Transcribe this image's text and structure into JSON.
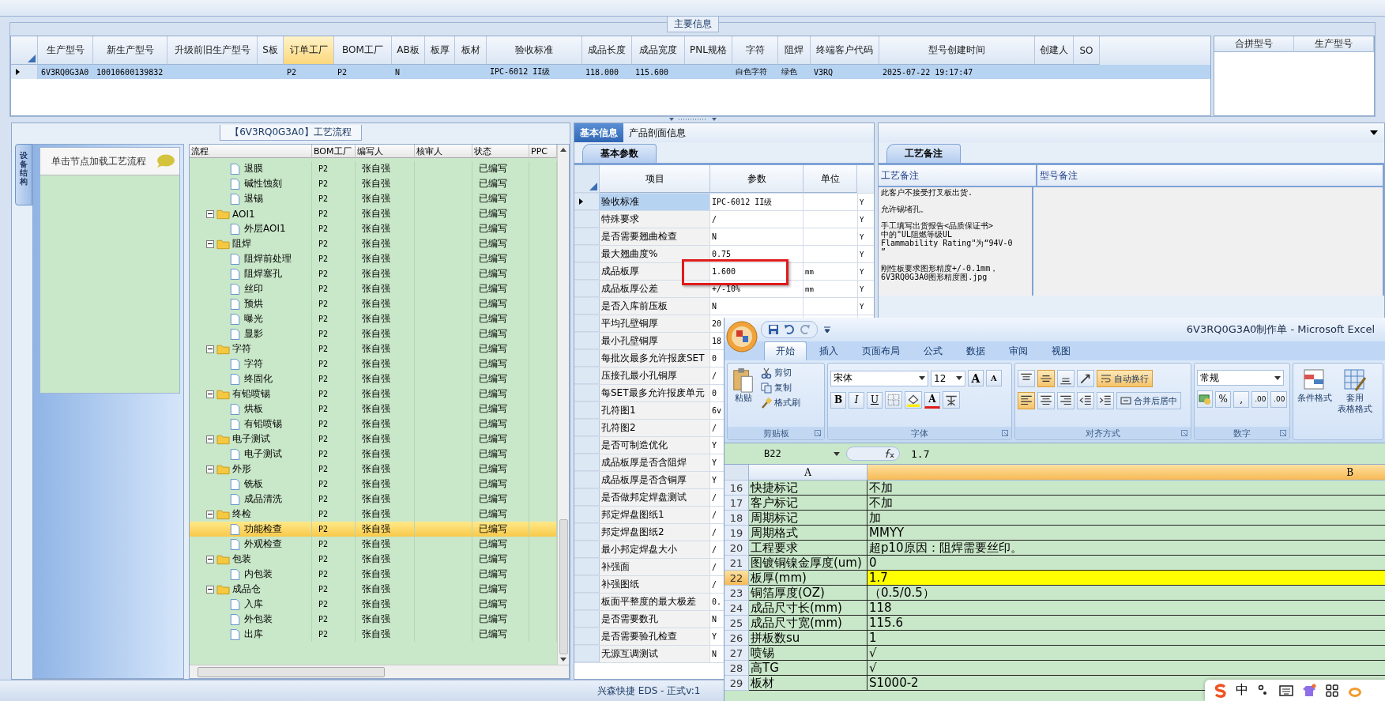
{
  "main_info": {
    "title": "主要信息",
    "columns": [
      {
        "label": "生产型号",
        "selected": false
      },
      {
        "label": "新生产型号",
        "selected": false
      },
      {
        "label": "升级前旧生产型号",
        "selected": false
      },
      {
        "label": "S板",
        "selected": false
      },
      {
        "label": "订单工厂",
        "selected": true
      },
      {
        "label": "BOM工厂",
        "selected": false
      },
      {
        "label": "AB板",
        "selected": false
      },
      {
        "label": "板厚",
        "selected": false
      },
      {
        "label": "板材",
        "selected": false
      },
      {
        "label": "验收标准",
        "selected": false
      },
      {
        "label": "成品长度",
        "selected": false
      },
      {
        "label": "成品宽度",
        "selected": false
      },
      {
        "label": "PNL规格",
        "selected": false
      },
      {
        "label": "字符",
        "selected": false
      },
      {
        "label": "阻焊",
        "selected": false
      },
      {
        "label": "终端客户代码",
        "selected": false
      },
      {
        "label": "型号创建时间",
        "selected": false
      },
      {
        "label": "创建人",
        "selected": false
      },
      {
        "label": "SO",
        "selected": false
      }
    ],
    "rows": [
      {
        "selected": true,
        "cells": [
          "6V3RQ0G3A0",
          "10010600139832",
          "",
          "",
          "P2",
          "P2",
          "N",
          "",
          "",
          "IPC-6012 II级",
          "118.000",
          "115.600",
          "",
          "白色字符",
          "绿色",
          "V3RQ",
          "2025-07-22 19:17:47",
          "",
          ""
        ]
      }
    ],
    "side_columns": [
      "合拼型号",
      "生产型号"
    ]
  },
  "process": {
    "title": "【6V3RQ0G3A0】工艺流程",
    "side_tab": "设备结构",
    "hint": "单击节点加载工艺流程",
    "columns": [
      "流程",
      "BOM工厂",
      "编写人",
      "核审人",
      "状态",
      "PPC"
    ],
    "tree": [
      {
        "kind": "step",
        "name": "退膜",
        "bom": "P2",
        "writer": "张自强",
        "status": "已编写",
        "selected": false
      },
      {
        "kind": "step",
        "name": "碱性蚀刻",
        "bom": "P2",
        "writer": "张自强",
        "status": "已编写",
        "selected": false
      },
      {
        "kind": "step",
        "name": "退锡",
        "bom": "P2",
        "writer": "张自强",
        "status": "已编写",
        "selected": false
      },
      {
        "kind": "folder",
        "name": "AOI1",
        "bom": "P2",
        "writer": "张自强",
        "status": "已编写",
        "selected": false,
        "expanded": true,
        "children": [
          {
            "kind": "step",
            "name": "外层AOI1",
            "bom": "P2",
            "writer": "张自强",
            "status": "已编写",
            "selected": false
          }
        ]
      },
      {
        "kind": "folder",
        "name": "阻焊",
        "bom": "P2",
        "writer": "张自强",
        "status": "已编写",
        "selected": false,
        "expanded": true,
        "children": [
          {
            "kind": "step",
            "name": "阻焊前处理",
            "bom": "P2",
            "writer": "张自强",
            "status": "已编写",
            "selected": false
          },
          {
            "kind": "step",
            "name": "阻焊塞孔",
            "bom": "P2",
            "writer": "张自强",
            "status": "已编写",
            "selected": false
          },
          {
            "kind": "step",
            "name": "丝印",
            "bom": "P2",
            "writer": "张自强",
            "status": "已编写",
            "selected": false
          },
          {
            "kind": "step",
            "name": "预烘",
            "bom": "P2",
            "writer": "张自强",
            "status": "已编写",
            "selected": false
          },
          {
            "kind": "step",
            "name": "曝光",
            "bom": "P2",
            "writer": "张自强",
            "status": "已编写",
            "selected": false
          },
          {
            "kind": "step",
            "name": "显影",
            "bom": "P2",
            "writer": "张自强",
            "status": "已编写",
            "selected": false
          }
        ]
      },
      {
        "kind": "folder",
        "name": "字符",
        "bom": "P2",
        "writer": "张自强",
        "status": "已编写",
        "selected": false,
        "expanded": true,
        "children": [
          {
            "kind": "step",
            "name": "字符",
            "bom": "P2",
            "writer": "张自强",
            "status": "已编写",
            "selected": false
          },
          {
            "kind": "step",
            "name": "终固化",
            "bom": "P2",
            "writer": "张自强",
            "status": "已编写",
            "selected": false
          }
        ]
      },
      {
        "kind": "folder",
        "name": "有铅喷锡",
        "bom": "P2",
        "writer": "张自强",
        "status": "已编写",
        "selected": false,
        "expanded": true,
        "children": [
          {
            "kind": "step",
            "name": "烘板",
            "bom": "P2",
            "writer": "张自强",
            "status": "已编写",
            "selected": false
          },
          {
            "kind": "step",
            "name": "有铅喷锡",
            "bom": "P2",
            "writer": "张自强",
            "status": "已编写",
            "selected": false
          }
        ]
      },
      {
        "kind": "folder",
        "name": "电子测试",
        "bom": "P2",
        "writer": "张自强",
        "status": "已编写",
        "selected": false,
        "expanded": true,
        "children": [
          {
            "kind": "step",
            "name": "电子测试",
            "bom": "P2",
            "writer": "张自强",
            "status": "已编写",
            "selected": false
          }
        ]
      },
      {
        "kind": "folder",
        "name": "外形",
        "bom": "P2",
        "writer": "张自强",
        "status": "已编写",
        "selected": false,
        "expanded": true,
        "children": [
          {
            "kind": "step",
            "name": "铣板",
            "bom": "P2",
            "writer": "张自强",
            "status": "已编写",
            "selected": false
          },
          {
            "kind": "step",
            "name": "成品清洗",
            "bom": "P2",
            "writer": "张自强",
            "status": "已编写",
            "selected": false
          }
        ]
      },
      {
        "kind": "folder",
        "name": "终检",
        "bom": "P2",
        "writer": "张自强",
        "status": "已编写",
        "selected": false,
        "expanded": true,
        "children": [
          {
            "kind": "step",
            "name": "功能检查",
            "bom": "P2",
            "writer": "张自强",
            "status": "已编写",
            "selected": true
          },
          {
            "kind": "step",
            "name": "外观检查",
            "bom": "P2",
            "writer": "张自强",
            "status": "已编写",
            "selected": false
          }
        ]
      },
      {
        "kind": "folder",
        "name": "包装",
        "bom": "P2",
        "writer": "张自强",
        "status": "已编写",
        "selected": false,
        "expanded": true,
        "children": [
          {
            "kind": "step",
            "name": "内包装",
            "bom": "P2",
            "writer": "张自强",
            "status": "已编写",
            "selected": false
          }
        ]
      },
      {
        "kind": "folder",
        "name": "成品仓",
        "bom": "P2",
        "writer": "张自强",
        "status": "已编写",
        "selected": false,
        "expanded": true,
        "children": [
          {
            "kind": "step",
            "name": "入库",
            "bom": "P2",
            "writer": "张自强",
            "status": "已编写",
            "selected": false
          },
          {
            "kind": "step",
            "name": "外包装",
            "bom": "P2",
            "writer": "张自强",
            "status": "已编写",
            "selected": false
          },
          {
            "kind": "step",
            "name": "出库",
            "bom": "P2",
            "writer": "张自强",
            "status": "已编写",
            "selected": false
          }
        ]
      }
    ]
  },
  "params": {
    "tabs": [
      {
        "label": "基本信息",
        "selected": true
      },
      {
        "label": "产品剖面信息",
        "selected": false
      }
    ],
    "subtab": "基本参数",
    "columns": [
      "项目",
      "参数",
      "单位"
    ],
    "rows": [
      {
        "item": "验收标准",
        "value": "IPC-6012 II级",
        "flag": "Y",
        "selected": true
      },
      {
        "item": "特殊要求",
        "value": "/",
        "flag": "Y",
        "selected": false
      },
      {
        "item": "是否需要翘曲检查",
        "value": "N",
        "flag": "Y",
        "selected": false
      },
      {
        "item": "最大翘曲度%",
        "value": "0.75",
        "flag": "Y",
        "selected": false
      },
      {
        "item": "成品板厚",
        "value": "1.600",
        "unit": "mm",
        "flag": "Y",
        "selected": false,
        "highlighted": true
      },
      {
        "item": "成品板厚公差",
        "value": "+/-10%",
        "unit": "mm",
        "flag": "Y",
        "selected": false
      },
      {
        "item": "是否入库前压板",
        "value": "N",
        "flag": "Y",
        "selected": false
      },
      {
        "item": "平均孔壁铜厚",
        "value": "20",
        "selected": false
      },
      {
        "item": "最小孔壁铜厚",
        "value": "18",
        "selected": false
      },
      {
        "item": "每批次最多允许报废SET",
        "value": "0",
        "selected": false
      },
      {
        "item": "压接孔最小孔铜厚",
        "value": "/",
        "selected": false
      },
      {
        "item": "每SET最多允许报废单元",
        "value": "0",
        "selected": false
      },
      {
        "item": "孔符图1",
        "value": "6v",
        "selected": false
      },
      {
        "item": "孔符图2",
        "value": "/",
        "selected": false
      },
      {
        "item": "是否可制造优化",
        "value": "Y",
        "selected": false
      },
      {
        "item": "成品板厚是否含阻焊",
        "value": "Y",
        "selected": false
      },
      {
        "item": "成品板厚是否含铜厚",
        "value": "Y",
        "selected": false
      },
      {
        "item": "是否做邦定焊盘测试",
        "value": "/",
        "selected": false
      },
      {
        "item": "邦定焊盘图纸1",
        "value": "/",
        "selected": false
      },
      {
        "item": "邦定焊盘图纸2",
        "value": "/",
        "selected": false
      },
      {
        "item": "最小邦定焊盘大小",
        "value": "/",
        "selected": false
      },
      {
        "item": "补强面",
        "value": "/",
        "selected": false
      },
      {
        "item": "补强图纸",
        "value": "/",
        "selected": false
      },
      {
        "item": "板面平整度的最大极差",
        "value": "0.",
        "selected": false
      },
      {
        "item": "是否需要数孔",
        "value": "N",
        "selected": false
      },
      {
        "item": "是否需要验孔检查",
        "value": "Y",
        "selected": false
      },
      {
        "item": "无源互调测试",
        "value": "N",
        "selected": false
      }
    ]
  },
  "notes": {
    "tab": "工艺备注",
    "columns": [
      "工艺备注",
      "型号备注"
    ],
    "process_note": [
      [
        "此客户不接受打叉板出货."
      ],
      [
        "允许锡堵孔。"
      ],
      [
        "手工填写出货报告<品质保证书>",
        "中的\"UL阻燃等级UL",
        "Flammability Rating\"为“94V-0",
        "”"
      ],
      [
        "刚性板要求图形精度+/-0.1mm，",
        "6V3RQ0G3A0图形精度图.jpg"
      ]
    ]
  },
  "status_bar": {
    "text": "兴森快捷 EDS - 正式v:1"
  },
  "excel": {
    "title": "6V3RQ0G3A0制作单 - Microsoft Excel",
    "tabs": [
      {
        "label": "开始",
        "selected": true
      },
      {
        "label": "插入",
        "selected": false
      },
      {
        "label": "页面布局",
        "selected": false
      },
      {
        "label": "公式",
        "selected": false
      },
      {
        "label": "数据",
        "selected": false
      },
      {
        "label": "审阅",
        "selected": false
      },
      {
        "label": "视图",
        "selected": false
      }
    ],
    "clipboard": {
      "label": "剪贴板",
      "paste": "粘贴",
      "cut": "剪切",
      "copy": "复制",
      "painter": "格式刷"
    },
    "font": {
      "label": "字体",
      "name": "宋体",
      "size": "12",
      "grow": "A",
      "shrink": "A",
      "bold": "B",
      "italic": "I",
      "underline": "U",
      "color_button": "A"
    },
    "align": {
      "label": "对齐方式",
      "wrap": "自动换行",
      "wrap_on": true,
      "merge": "合并后居中"
    },
    "number": {
      "label": "数字",
      "format": "常规",
      "percent": "%",
      "comma": ",",
      "more_decimals": ".00",
      "fewer_decimals": ".00"
    },
    "styles": {
      "conditional": "条件格式",
      "table_top": "套用",
      "table_bottom": "表格格式"
    },
    "name_box": "B22",
    "formula": "1.7",
    "columns": [
      {
        "label": "A",
        "selected": false
      },
      {
        "label": "B",
        "selected": true
      }
    ],
    "rows": [
      {
        "n": "16",
        "a": "快捷标记",
        "b": "不加",
        "selected": false
      },
      {
        "n": "17",
        "a": "客户标记",
        "b": "不加",
        "selected": false
      },
      {
        "n": "18",
        "a": "周期标记",
        "b": "加",
        "selected": false
      },
      {
        "n": "19",
        "a": "周期格式",
        "b": "MMYY",
        "selected": false
      },
      {
        "n": "20",
        "a": "工程要求",
        "b": "超p10原因：阻焊需要丝印。",
        "selected": false
      },
      {
        "n": "21",
        "a": "图镀铜镍金厚度(um)",
        "b": "0",
        "selected": false
      },
      {
        "n": "22",
        "a": "板厚(mm)",
        "b": "1.7",
        "selected": true
      },
      {
        "n": "23",
        "a": "铜箔厚度(OZ)",
        "b": "（0.5/0.5）",
        "selected": false
      },
      {
        "n": "24",
        "a": "成品尺寸长(mm)",
        "b": "118",
        "selected": false
      },
      {
        "n": "25",
        "a": "成品尺寸宽(mm)",
        "b": "115.6",
        "selected": false
      },
      {
        "n": "26",
        "a": "拼板数su",
        "b": "1",
        "selected": false
      },
      {
        "n": "27",
        "a": "喷锡",
        "b": "√",
        "selected": false
      },
      {
        "n": "28",
        "a": "高TG",
        "b": "√",
        "selected": false
      },
      {
        "n": "29",
        "a": "板材",
        "b": "S1000-2",
        "selected": false
      }
    ]
  },
  "ime": {
    "mode": "中"
  }
}
